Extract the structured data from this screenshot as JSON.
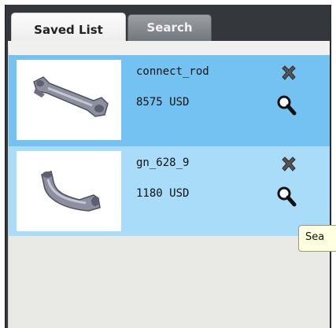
{
  "tabs": [
    {
      "label": "Saved List",
      "active": true
    },
    {
      "label": "Search",
      "active": false
    }
  ],
  "saved_items": [
    {
      "name": "connect_rod",
      "price": "8575 USD",
      "thumbnail_icon": "connecting-rod-part",
      "delete_icon": "delete-x-icon",
      "view_icon": "magnifier-icon"
    },
    {
      "name": "gn_628_9",
      "price": "1180 USD",
      "thumbnail_icon": "u-handle-part",
      "delete_icon": "delete-x-icon",
      "view_icon": "magnifier-icon"
    }
  ],
  "tooltip": {
    "text": "Sea"
  },
  "colors": {
    "frame": "#34373c",
    "selected_row": "#74c2f2",
    "row": "#a9dcf9",
    "panel_bg": "#e9e9e6",
    "tooltip_bg": "#ffffe1"
  }
}
